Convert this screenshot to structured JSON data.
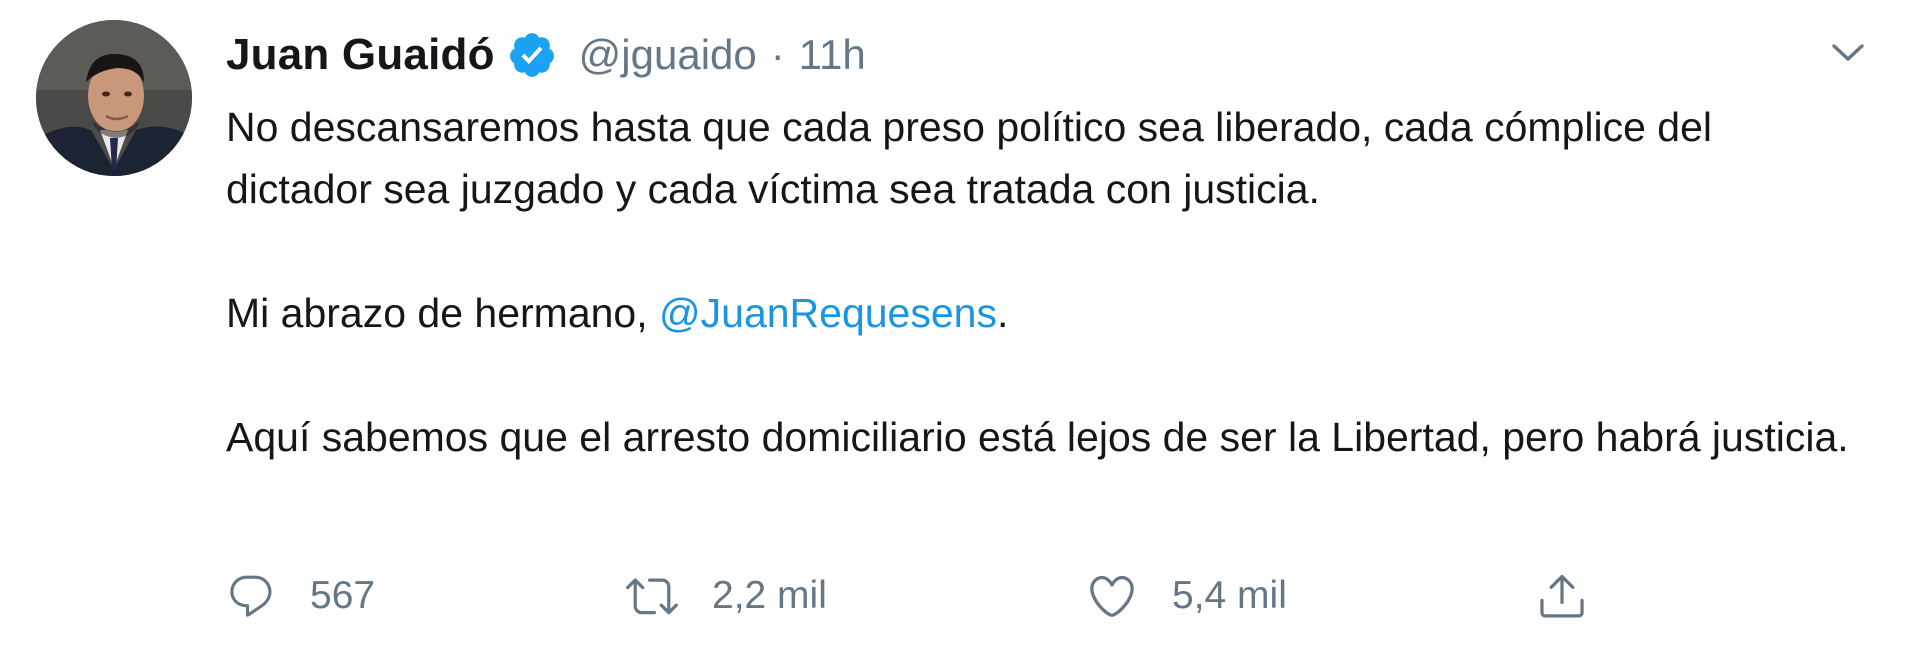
{
  "tweet": {
    "author": {
      "name": "Juan Guaidó",
      "handle": "@jguaido",
      "verified": true
    },
    "separator": "·",
    "time": "11h",
    "paragraphs": [
      {
        "text": "No descansaremos hasta que cada preso político sea liberado, cada cómplice del dictador sea juzgado y cada víctima sea tratada con justicia."
      },
      {
        "before": "Mi abrazo de hermano, ",
        "mention": "@JuanRequesens",
        "after": "."
      },
      {
        "text": "Aquí sabemos que el arresto domiciliario está lejos de ser la Libertad, pero habrá justicia."
      }
    ],
    "actions": {
      "reply_count": "567",
      "retweet_count": "2,2 mil",
      "like_count": "5,4 mil"
    }
  },
  "icons": {
    "verified": "verified-badge-icon",
    "caret": "chevron-down-icon",
    "reply": "reply-icon",
    "retweet": "retweet-icon",
    "like": "heart-icon",
    "share": "share-icon"
  },
  "colors": {
    "text": "#14171a",
    "secondary": "#657786",
    "link": "#1b95e0",
    "verified": "#1da1f2"
  }
}
